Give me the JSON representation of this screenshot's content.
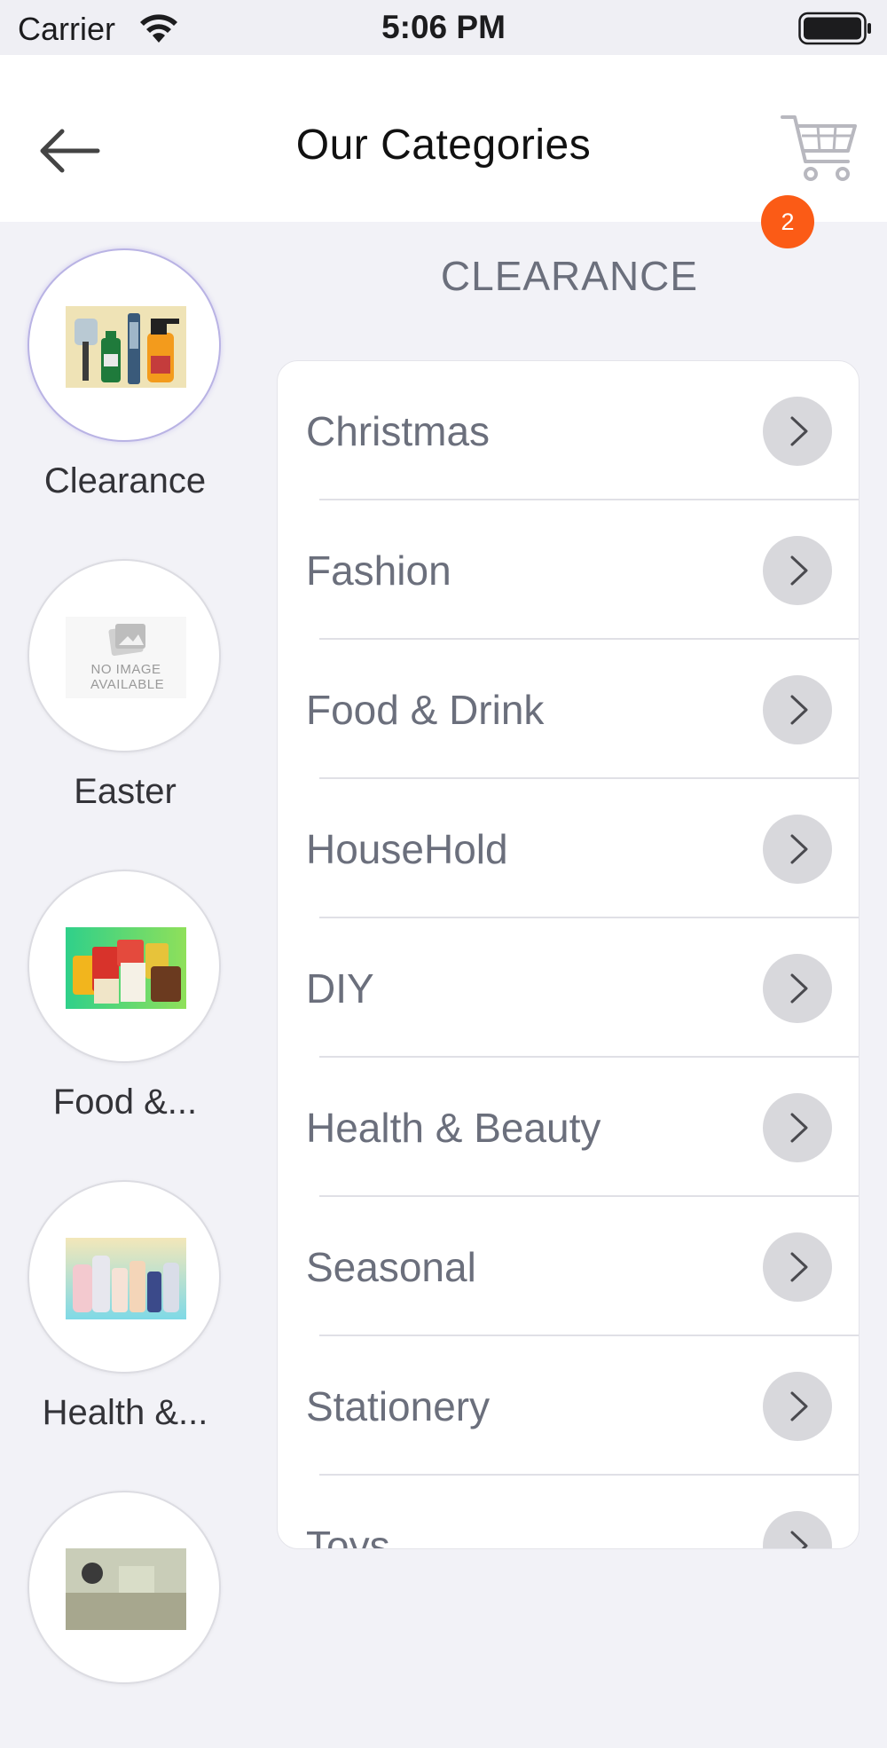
{
  "status_bar": {
    "carrier": "Carrier",
    "time": "5:06 PM"
  },
  "nav": {
    "title": "Our Categories",
    "cart_count": "2"
  },
  "rail": {
    "items": [
      {
        "label": "Clearance",
        "image": "clearance-products"
      },
      {
        "label": "Easter",
        "image": "no-image-available",
        "placeholder_text": "NO IMAGE AVAILABLE"
      },
      {
        "label": "Food &...",
        "image": "food-products"
      },
      {
        "label": "Health &...",
        "image": "health-products"
      }
    ]
  },
  "section": {
    "title": "CLEARANCE",
    "items": [
      {
        "label": "Christmas"
      },
      {
        "label": "Fashion"
      },
      {
        "label": "Food & Drink"
      },
      {
        "label": "HouseHold"
      },
      {
        "label": "DIY"
      },
      {
        "label": "Health & Beauty"
      },
      {
        "label": "Seasonal"
      },
      {
        "label": "Stationery"
      },
      {
        "label": "Toys"
      }
    ]
  },
  "colors": {
    "accent_badge": "#fb5b16",
    "background": "#f2f2f7",
    "row_text": "#6b6f7c"
  }
}
